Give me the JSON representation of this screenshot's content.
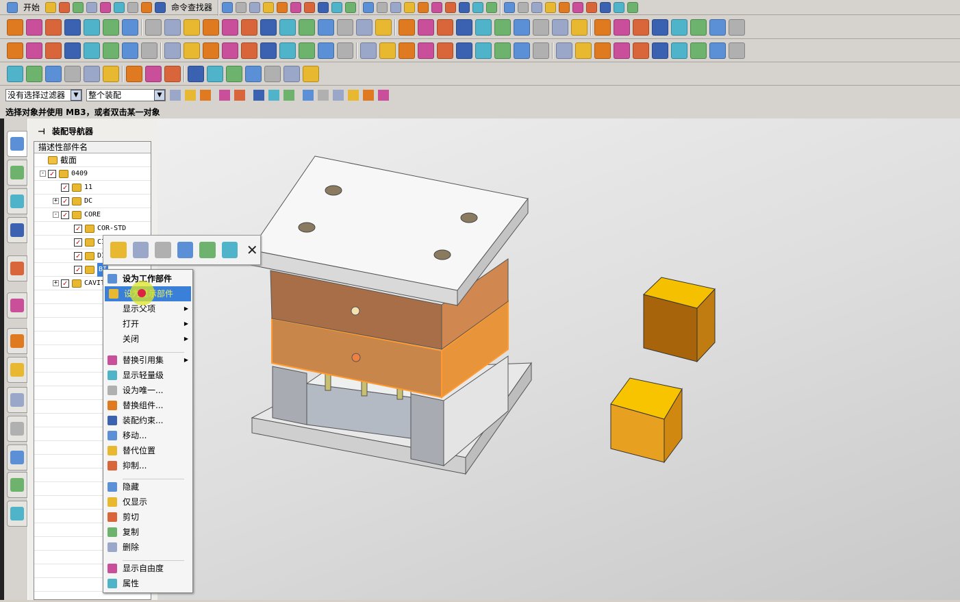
{
  "toolbar": {
    "start_label": "开始",
    "command_finder_label": "命令查找器",
    "row1_icons": [
      "start-menu-icon",
      "new-file-icon",
      "open-file-icon",
      "save-icon",
      "cut-icon",
      "copy-icon",
      "paste-icon",
      "undo-icon",
      "redo-icon",
      "command-finder-icon"
    ]
  },
  "filter_bar": {
    "selection_filter": "没有选择过滤器",
    "scope": "整个装配"
  },
  "status_line": "选择对象并使用 MB3，或者双击某一对象",
  "navigator": {
    "title": "装配导航器",
    "column_header": "描述性部件名",
    "rows": [
      {
        "label": "截面",
        "level": 0,
        "type": "folder"
      },
      {
        "label": "0409",
        "level": 0,
        "expander": "-",
        "checked": true
      },
      {
        "label": "11",
        "level": 1,
        "checked": true
      },
      {
        "label": "DC",
        "level": 1,
        "expander": "+",
        "checked": true
      },
      {
        "label": "CORE",
        "level": 1,
        "expander": "-",
        "checked": true
      },
      {
        "label": "COR-STD",
        "level": 2,
        "checked": true
      },
      {
        "label": "CI",
        "level": 2,
        "checked": true
      },
      {
        "label": "DI",
        "level": 2,
        "checked": true
      },
      {
        "label": "BI",
        "level": 2,
        "checked": true,
        "selected": true
      },
      {
        "label": "CAVIT",
        "level": 1,
        "expander": "+",
        "checked": true
      }
    ]
  },
  "mini_toolbar": [
    "assembly-constraint-icon",
    "components-icon",
    "display-part-icon",
    "move-component-icon",
    "reposition-icon",
    "wave-link-icon",
    "close-icon"
  ],
  "context_menu": {
    "groups": [
      [
        {
          "label": "设为工作部件",
          "icon": "make-work-part-icon",
          "bold": true
        },
        {
          "label": "设为显示部件",
          "icon": "make-displayed-part-icon",
          "highlighted": true
        },
        {
          "label": "显示父项",
          "submenu": true
        },
        {
          "label": "打开",
          "submenu": true
        },
        {
          "label": "关闭",
          "submenu": true
        }
      ],
      [
        {
          "label": "替换引用集",
          "icon": "replace-reference-set-icon",
          "submenu": true
        },
        {
          "label": "显示轻量级",
          "icon": "lightweight-icon"
        },
        {
          "label": "设为唯一...",
          "icon": "make-unique-icon"
        },
        {
          "label": "替换组件...",
          "icon": "replace-component-icon"
        },
        {
          "label": "装配约束...",
          "icon": "assembly-constraints-icon"
        },
        {
          "label": "移动...",
          "icon": "move-icon"
        },
        {
          "label": "替代位置",
          "icon": "alternate-position-icon"
        },
        {
          "label": "抑制...",
          "icon": "suppress-icon"
        }
      ],
      [
        {
          "label": "隐藏",
          "icon": "hide-icon"
        },
        {
          "label": "仅显示",
          "icon": "show-only-icon"
        },
        {
          "label": "剪切",
          "icon": "cut-icon"
        },
        {
          "label": "复制",
          "icon": "copy-icon"
        },
        {
          "label": "删除",
          "icon": "delete-icon"
        }
      ],
      [
        {
          "label": "显示自由度",
          "icon": "degrees-of-freedom-icon"
        },
        {
          "label": "属性",
          "icon": "properties-icon"
        }
      ]
    ]
  },
  "colors": {
    "selection": "#3a80d8",
    "highlight_text": "#e8f06a",
    "selected_plate": "#e8943a",
    "cube": "#f0b000"
  }
}
